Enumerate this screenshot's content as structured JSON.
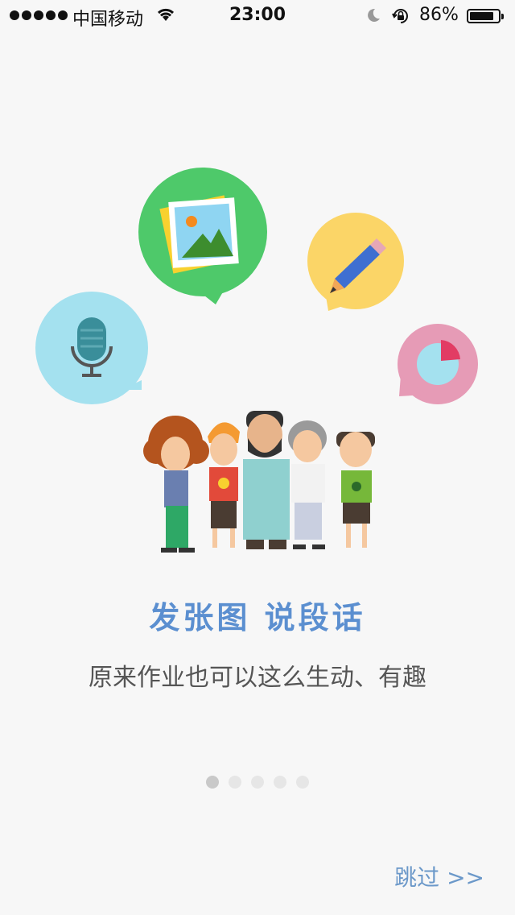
{
  "status_bar": {
    "carrier": "中国移动",
    "time": "23:00",
    "battery_percent": "86%",
    "battery_level": 0.86,
    "signal_bars": 5,
    "icons": [
      "signal-dots-icon",
      "wifi-icon",
      "moon-icon",
      "rotation-lock-icon",
      "battery-icon"
    ]
  },
  "onboarding": {
    "headline": "发张图 说段话",
    "subtitle": "原来作业也可以这么生动、有趣",
    "page_count": 5,
    "current_page": 1,
    "skip_label": "跳过 >>"
  },
  "illustration": {
    "bubbles": [
      {
        "name": "picture-bubble",
        "color": "#4ec96a",
        "icon": "picture-icon"
      },
      {
        "name": "pencil-bubble",
        "color": "#fbd567",
        "icon": "pencil-icon"
      },
      {
        "name": "microphone-bubble",
        "color": "#a4e1ef",
        "icon": "microphone-icon"
      },
      {
        "name": "pie-chart-bubble",
        "color": "#e69bb6",
        "icon": "pie-chart-icon"
      }
    ],
    "people_count": 5
  },
  "colors": {
    "background": "#f7f7f7",
    "headline": "#5b8fd0",
    "skip": "#6b98c9"
  }
}
